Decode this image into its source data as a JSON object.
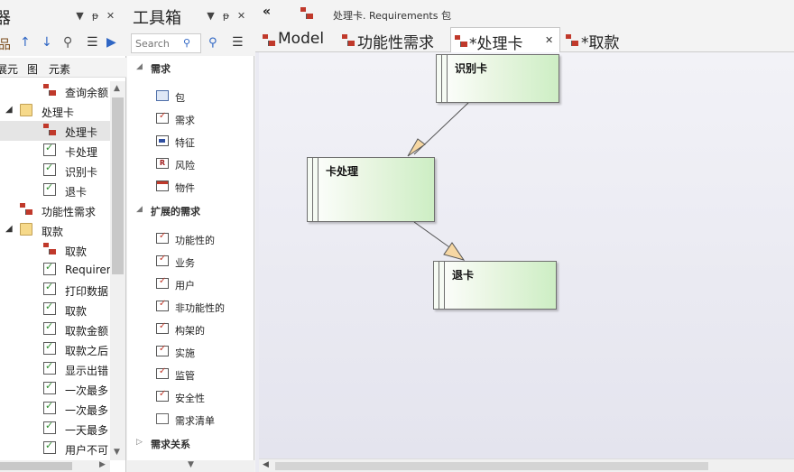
{
  "browser": {
    "title": "器",
    "tabs": [
      "展元",
      "图",
      "元素"
    ],
    "tree": [
      {
        "label": "查询余额",
        "icon": "diagram",
        "indent": 48,
        "expander": ""
      },
      {
        "label": "处理卡",
        "icon": "folder",
        "indent": 22,
        "expander": "◢"
      },
      {
        "label": "处理卡",
        "icon": "diagram",
        "indent": 48,
        "expander": "",
        "selected": true
      },
      {
        "label": "卡处理",
        "icon": "check",
        "indent": 48,
        "expander": ""
      },
      {
        "label": "识别卡",
        "icon": "check",
        "indent": 48,
        "expander": ""
      },
      {
        "label": "退卡",
        "icon": "check",
        "indent": 48,
        "expander": ""
      },
      {
        "label": "功能性需求",
        "icon": "diagram",
        "indent": 22,
        "expander": ""
      },
      {
        "label": "取款",
        "icon": "folder",
        "indent": 22,
        "expander": "◢"
      },
      {
        "label": "取款",
        "icon": "diagram",
        "indent": 48,
        "expander": ""
      },
      {
        "label": "Requirements",
        "icon": "check",
        "indent": 48,
        "expander": ""
      },
      {
        "label": "打印数据",
        "icon": "check",
        "indent": 48,
        "expander": ""
      },
      {
        "label": "取款",
        "icon": "check",
        "indent": 48,
        "expander": ""
      },
      {
        "label": "取款金额",
        "icon": "check",
        "indent": 48,
        "expander": ""
      },
      {
        "label": "取款之后",
        "icon": "check",
        "indent": 48,
        "expander": ""
      },
      {
        "label": "显示出错",
        "icon": "check",
        "indent": 48,
        "expander": ""
      },
      {
        "label": "一次最多",
        "icon": "check",
        "indent": 48,
        "expander": ""
      },
      {
        "label": "一次最多",
        "icon": "check",
        "indent": 48,
        "expander": ""
      },
      {
        "label": "一天最多",
        "icon": "check",
        "indent": 48,
        "expander": ""
      },
      {
        "label": "用户不可",
        "icon": "check",
        "indent": 48,
        "expander": ""
      }
    ]
  },
  "toolbox": {
    "title": "工具箱",
    "search_placeholder": "Search",
    "groups": [
      {
        "label": "需求",
        "caret": "◢",
        "items": [
          {
            "label": "包",
            "icon": "package"
          },
          {
            "label": "需求",
            "icon": "req"
          },
          {
            "label": "特征",
            "icon": "feat"
          },
          {
            "label": "风险",
            "icon": "risk"
          },
          {
            "label": "物件",
            "icon": "artifact"
          }
        ]
      },
      {
        "label": "扩展的需求",
        "caret": "◢",
        "items": [
          {
            "label": "功能性的",
            "icon": "req"
          },
          {
            "label": "业务",
            "icon": "req"
          },
          {
            "label": "用户",
            "icon": "req"
          },
          {
            "label": "非功能性的",
            "icon": "req"
          },
          {
            "label": "构架的",
            "icon": "req"
          },
          {
            "label": "实施",
            "icon": "req"
          },
          {
            "label": "监管",
            "icon": "req"
          },
          {
            "label": "安全性",
            "icon": "req"
          },
          {
            "label": "需求清单",
            "icon": "doc"
          }
        ]
      },
      {
        "label": "需求关系",
        "caret": "▷",
        "items": []
      }
    ]
  },
  "breadcrumb": {
    "text": "处理卡.  Requirements 包"
  },
  "doc_tabs": [
    {
      "label": "Model",
      "active": false
    },
    {
      "label": "功能性需求",
      "active": false
    },
    {
      "label": "*处理卡",
      "active": true
    },
    {
      "label": "*取款",
      "active": false
    }
  ],
  "diagram": {
    "elements": [
      {
        "id": "识别卡",
        "name": "识别卡"
      },
      {
        "id": "卡处理",
        "name": "卡处理"
      },
      {
        "id": "退卡",
        "name": "退卡"
      }
    ]
  }
}
